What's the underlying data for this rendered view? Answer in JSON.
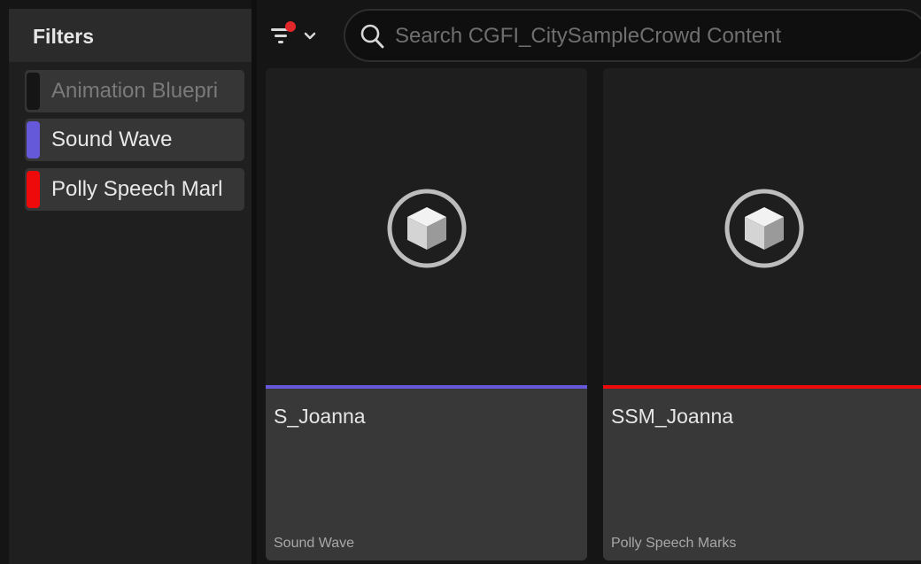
{
  "sidebar": {
    "title": "Filters",
    "filters": [
      {
        "label": "Animation Bluepri",
        "color": "#151515",
        "enabled": false
      },
      {
        "label": "Sound Wave",
        "color": "#6659d9",
        "enabled": true
      },
      {
        "label": "Polly Speech Marl",
        "color": "#ee0a0a",
        "enabled": true
      }
    ]
  },
  "toolbar": {
    "filter_icon": "filter-icon",
    "dropdown_icon": "chevron-down-icon",
    "search_placeholder": "Search CGFI_CitySampleCrowd Content",
    "search_value": ""
  },
  "assets": [
    {
      "name": "S_Joanna",
      "type": "Sound Wave",
      "color": "#6659d9",
      "icon": "cube-icon"
    },
    {
      "name": "SSM_Joanna",
      "type": "Polly Speech Marks",
      "color": "#ee0a0a",
      "icon": "cube-icon"
    }
  ],
  "colors": {
    "filter_badge": "#e2272a"
  }
}
